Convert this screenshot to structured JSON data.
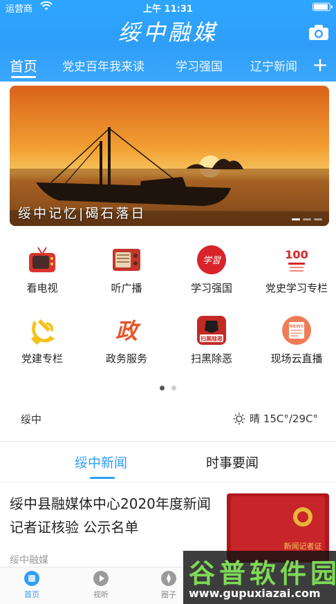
{
  "status_bar": {
    "carrier": "运营商",
    "time": "上午 11:31"
  },
  "header": {
    "title": "绥中融媒",
    "camera_icon": "camera-icon",
    "add_icon": "plus-icon",
    "add_label": "+"
  },
  "tabs": [
    {
      "label": "首页",
      "active": true
    },
    {
      "label": "党史百年我来读"
    },
    {
      "label": "学习强国"
    },
    {
      "label": "辽宁新闻"
    }
  ],
  "banner": {
    "caption": "绥中记忆|碣石落日",
    "slide_count": 3,
    "active_slide": 1
  },
  "grid": [
    {
      "label": "看电视",
      "icon": "tv-icon"
    },
    {
      "label": "听广播",
      "icon": "radio-icon"
    },
    {
      "label": "学习强国",
      "icon": "xuexi-icon",
      "icon_text": "学習"
    },
    {
      "label": "党史学习专栏",
      "icon": "party-history-icon",
      "icon_text": "100"
    },
    {
      "label": "党建专栏",
      "icon": "party-emblem-icon"
    },
    {
      "label": "政务服务",
      "icon": "government-icon",
      "icon_text": "政"
    },
    {
      "label": "扫黑除恶",
      "icon": "anti-crime-icon",
      "icon_text": "扫黑除恶"
    },
    {
      "label": "现场云直播",
      "icon": "live-news-icon",
      "icon_text": "NEWS"
    }
  ],
  "grid_pages": {
    "count": 2,
    "active": 1
  },
  "weather": {
    "location": "绥中",
    "condition": "晴",
    "temperature": "15C°/29C°",
    "icon": "sun-icon"
  },
  "news_tabs": [
    {
      "label": "绥中新闻",
      "active": true
    },
    {
      "label": "时事要闻"
    }
  ],
  "news": [
    {
      "title": "绥中县融媒体中心2020年度新闻记者证核验 公示名单",
      "source": "绥中融媒",
      "thumb_text": "新闻记者证"
    }
  ],
  "bottom_nav": [
    {
      "label": "首页",
      "icon": "home-icon",
      "active": true
    },
    {
      "label": "视听",
      "icon": "play-icon"
    },
    {
      "label": "圈子",
      "icon": "circle-icon"
    }
  ],
  "watermark": {
    "text": "谷普软件园",
    "url": "www.gupuxiazai.com"
  },
  "colors": {
    "brand": "#2f9ef8",
    "header_top": "#2ea6ff",
    "text": "#222222",
    "muted": "#999999"
  }
}
